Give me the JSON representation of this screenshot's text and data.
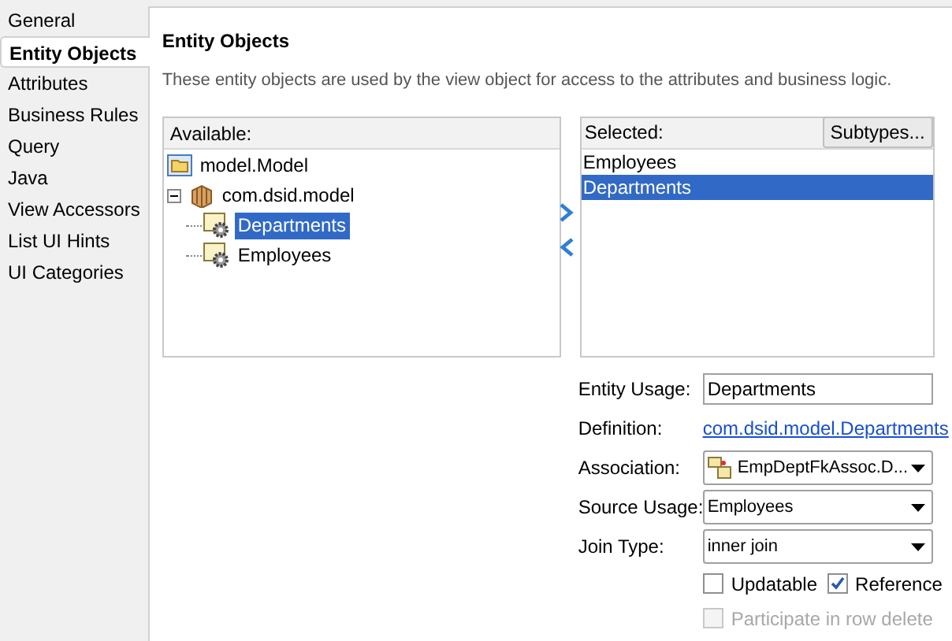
{
  "nav": [
    {
      "label": "General",
      "selected": false
    },
    {
      "label": "Entity Objects",
      "selected": true
    },
    {
      "label": "Attributes",
      "selected": false
    },
    {
      "label": "Business Rules",
      "selected": false
    },
    {
      "label": "Query",
      "selected": false
    },
    {
      "label": "Java",
      "selected": false
    },
    {
      "label": "View Accessors",
      "selected": false
    },
    {
      "label": "List UI Hints",
      "selected": false
    },
    {
      "label": "UI Categories",
      "selected": false
    }
  ],
  "title": "Entity Objects",
  "description": "These entity objects are used by the view object for access to the attributes and business logic.",
  "available": {
    "header": "Available:",
    "tree": [
      {
        "label": "model.Model",
        "kind": "project",
        "selected": false,
        "children": [
          {
            "label": "com.dsid.model",
            "kind": "package",
            "selected": false,
            "expanded": true,
            "children": [
              {
                "label": "Departments",
                "kind": "entity",
                "selected": true
              },
              {
                "label": "Employees",
                "kind": "entity",
                "selected": false
              }
            ]
          }
        ]
      }
    ]
  },
  "selected_list": {
    "header": "Selected:",
    "button": "Subtypes...",
    "items": [
      {
        "label": "Employees",
        "selected": false
      },
      {
        "label": "Departments",
        "selected": true
      }
    ]
  },
  "form": [
    {
      "kind": "text",
      "label": "Entity Usage:",
      "value": "Departments"
    },
    {
      "kind": "link",
      "label": "Definition:",
      "value": "com.dsid.model.Departments"
    },
    {
      "kind": "select",
      "label": "Association:",
      "value": "EmpDeptFkAssoc.D...",
      "icon": true
    },
    {
      "kind": "select",
      "label": "Source Usage:",
      "value": "Employees"
    },
    {
      "kind": "select",
      "label": "Join Type:",
      "value": "inner join"
    }
  ],
  "checkboxes": [
    {
      "label": "Updatable",
      "checked": false,
      "disabled": false
    },
    {
      "label": "Reference",
      "checked": true,
      "disabled": false
    }
  ],
  "participate": {
    "label": "Participate in row delete",
    "checked": false,
    "disabled": true
  }
}
